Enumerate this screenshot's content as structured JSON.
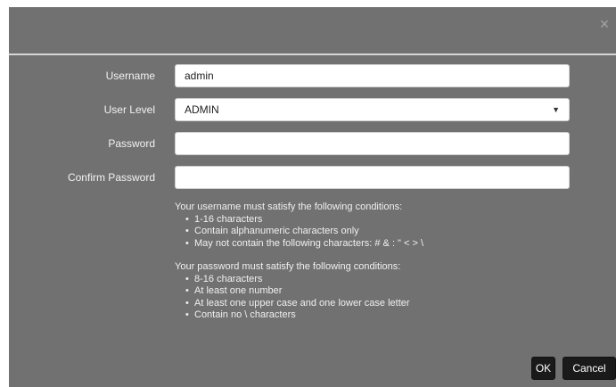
{
  "dialog": {
    "close_icon": "×"
  },
  "form": {
    "username": {
      "label": "Username",
      "value": "admin"
    },
    "user_level": {
      "label": "User Level",
      "value": "ADMIN",
      "caret": "▼"
    },
    "password": {
      "label": "Password",
      "value": ""
    },
    "confirm_password": {
      "label": "Confirm Password",
      "value": ""
    }
  },
  "username_rules": {
    "heading": "Your username must satisfy the following conditions:",
    "items": [
      "1-16 characters",
      "Contain alphanumeric characters only",
      "May not contain the following characters: # & : \" < > \\"
    ]
  },
  "password_rules": {
    "heading": "Your password must satisfy the following conditions:",
    "items": [
      "8-16 characters",
      "At least one number",
      "At least one upper case and one lower case letter",
      "Contain no \\ characters"
    ]
  },
  "buttons": {
    "ok": "OK",
    "cancel": "Cancel"
  }
}
